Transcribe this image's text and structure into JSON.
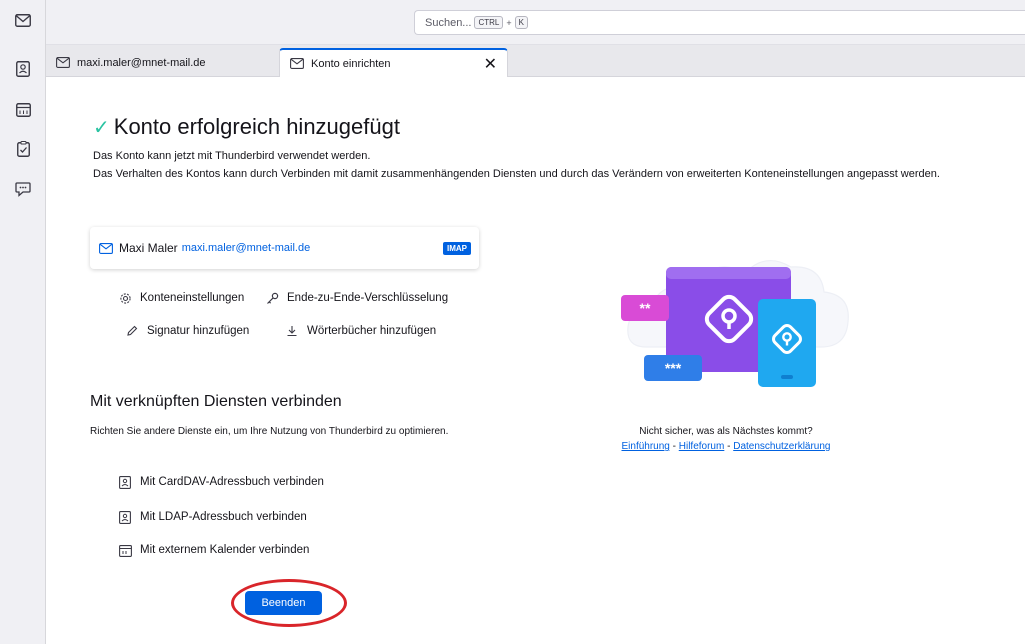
{
  "spaces": [
    "mail-icon",
    "address-book-icon",
    "calendar-icon",
    "tasks-icon",
    "chat-icon"
  ],
  "search": {
    "placeholder": "Suchen...",
    "kbd_ctrl": "CTRL",
    "plus": "+",
    "kbd_k": "K"
  },
  "tabs": [
    {
      "label": "maxi.maler@mnet-mail.de",
      "icon": "mail-account-icon"
    },
    {
      "label": "Konto einrichten",
      "icon": "mail-account-icon",
      "close": "✕"
    }
  ],
  "main": {
    "title": "Konto erfolgreich hinzugefügt",
    "desc1": "Das Konto kann jetzt mit Thunderbird verwendet werden.",
    "desc2": "Das Verhalten des Kontos kann durch Verbinden mit damit zusammenhängenden Diensten und durch das Verändern von erweiterten Konteneinstellungen angepasst werden.",
    "account": {
      "name": "Maxi Maler",
      "email": "maxi.maler@mnet-mail.de",
      "type": "IMAP"
    },
    "actions": {
      "settings": "Konteneinstellungen",
      "e2e": "Ende-zu-Ende-Verschlüsselung",
      "signature": "Signatur hinzufügen",
      "dictionaries": "Wörterbücher hinzufügen"
    },
    "services_heading": "Mit verknüpften Diensten verbinden",
    "services_desc": "Richten Sie andere Dienste ein, um Ihre Nutzung von Thunderbird zu optimieren.",
    "services": {
      "carddav": "Mit CardDAV-Adressbuch verbinden",
      "ldap": "Mit LDAP-Adressbuch verbinden",
      "calendar": "Mit externem Kalender verbinden"
    },
    "finish": "Beenden",
    "unsure": "Nicht sicher, was als Nächstes kommt?",
    "help": {
      "intro": "Einführung",
      "sep1": " - ",
      "forum": "Hilfeforum",
      "sep2": " - ",
      "privacy": "Datenschutzerklärung"
    },
    "illustration": {
      "mask1": "**",
      "mask2": "***"
    }
  },
  "colors": {
    "accent": "#0061e0",
    "highlight_ring": "#d9252a",
    "check": "#2ac3a2"
  }
}
